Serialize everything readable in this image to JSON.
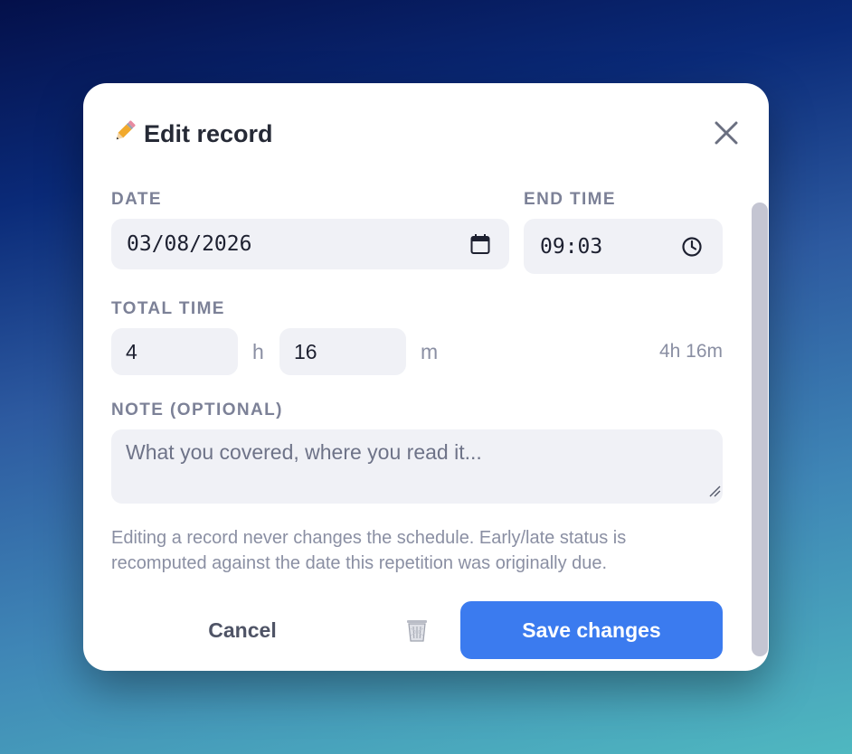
{
  "dialog": {
    "title": "Edit record",
    "icon": "pencil-icon",
    "close_icon": "close-icon"
  },
  "form": {
    "date": {
      "label": "DATE",
      "value": "03/08/2026",
      "icon": "calendar-icon"
    },
    "end_time": {
      "label": "END TIME",
      "value": "09:03",
      "icon": "clock-icon"
    },
    "total_time": {
      "label": "TOTAL TIME",
      "hours": "4",
      "hours_unit": "h",
      "minutes": "16",
      "minutes_unit": "m",
      "summary": "4h 16m"
    },
    "note": {
      "label": "NOTE (OPTIONAL)",
      "placeholder": "What you covered, where you read it...",
      "value": ""
    },
    "hint": "Editing a record never changes the schedule. Early/late status is recomputed against the date this repetition was originally due."
  },
  "actions": {
    "cancel_label": "Cancel",
    "delete_icon": "trash-icon",
    "save_label": "Save changes"
  },
  "colors": {
    "accent": "#3b7bef",
    "field_bg": "#f0f1f6",
    "label": "#7c8197"
  }
}
